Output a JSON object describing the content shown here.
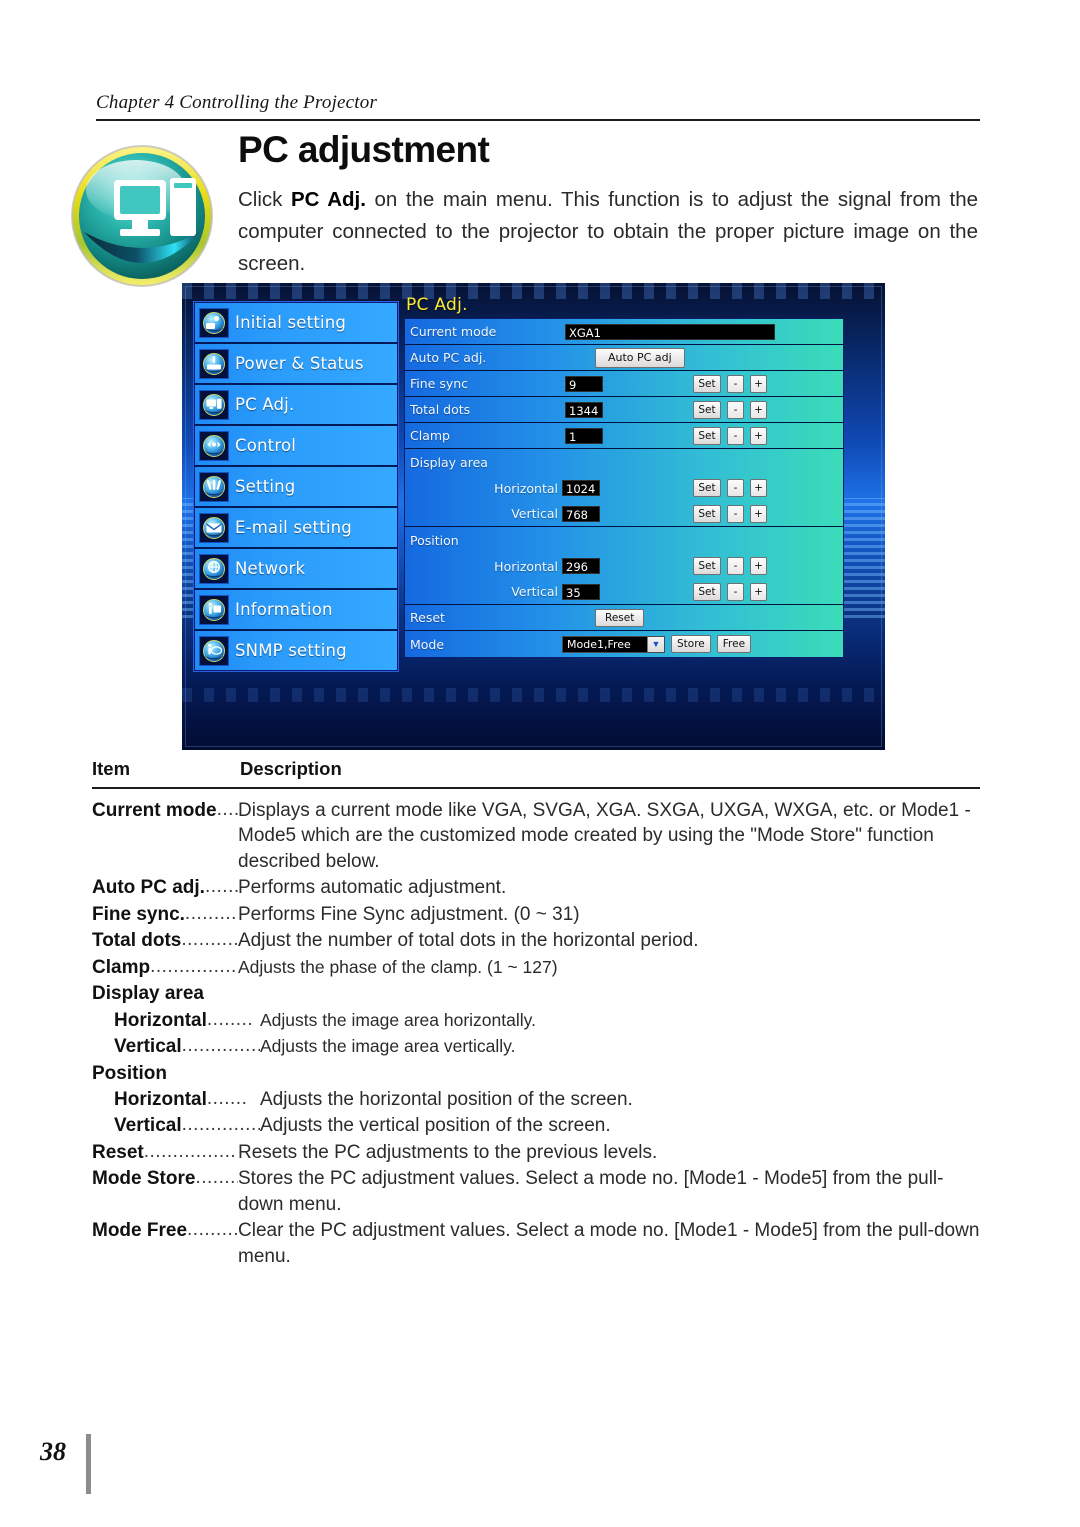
{
  "header": {
    "chapter": "Chapter 4 Controlling the Projector"
  },
  "title": "PC adjustment",
  "intro": {
    "pre": "Click ",
    "bold": "PC Adj.",
    "post": " on the main menu. This function is to adjust the signal from the computer connected to the projector to obtain the proper picture image on the screen."
  },
  "badge": {
    "icon": "computer-monitor-tower-icon",
    "ring_color": "#f2e430",
    "body_color": "#17a69e"
  },
  "screenshot": {
    "nav": {
      "items": [
        {
          "label": "Initial setting",
          "icon": "initial-setting-icon"
        },
        {
          "label": "Power & Status",
          "icon": "power-status-icon"
        },
        {
          "label": "PC Adj.",
          "icon": "pc-adj-icon"
        },
        {
          "label": "Control",
          "icon": "control-icon"
        },
        {
          "label": "Setting",
          "icon": "setting-icon"
        },
        {
          "label": "E-mail setting",
          "icon": "email-icon"
        },
        {
          "label": "Network",
          "icon": "network-icon"
        },
        {
          "label": "Information",
          "icon": "information-icon"
        },
        {
          "label": "SNMP setting",
          "icon": "snmp-setting-icon"
        }
      ]
    },
    "panel": {
      "title": "PC Adj.",
      "title_color": "#ffe92e",
      "row_gradient_start": "#1569e0",
      "row_gradient_end": "#3bdcb8",
      "rows": {
        "current_mode": {
          "label": "Current mode",
          "value": "XGA1"
        },
        "auto_pc_adj": {
          "label": "Auto PC adj.",
          "button": "Auto PC adj"
        },
        "fine_sync": {
          "label": "Fine sync",
          "value": "9"
        },
        "total_dots": {
          "label": "Total dots",
          "value": "1344"
        },
        "clamp": {
          "label": "Clamp",
          "value": "1"
        },
        "display_area": {
          "label": "Display area",
          "horizontal": {
            "label": "Horizontal",
            "value": "1024"
          },
          "vertical": {
            "label": "Vertical",
            "value": "768"
          }
        },
        "position": {
          "label": "Position",
          "horizontal": {
            "label": "Horizontal",
            "value": "296"
          },
          "vertical": {
            "label": "Vertical",
            "value": "35"
          }
        },
        "reset": {
          "label": "Reset",
          "button": "Reset"
        },
        "mode": {
          "label": "Mode",
          "value": "Mode1,Free",
          "store_button": "Store",
          "free_button": "Free"
        }
      },
      "buttons": {
        "set": "Set",
        "minus": "-",
        "plus": "+",
        "dropdown_arrow": "▼"
      }
    }
  },
  "table": {
    "head": {
      "item": "Item",
      "description": "Description"
    },
    "rows": [
      {
        "term": "Current mode",
        "leader": "......",
        "body": "Displays a current mode like VGA, SVGA, XGA. SXGA, UXGA, WXGA, etc. or Mode1 - Mode5 which are the customized mode created by using the \"Mode Store\" function described below."
      },
      {
        "term": "Auto PC adj.",
        "leader": "..........",
        "body": "Performs automatic adjustment."
      },
      {
        "term": "Fine sync.",
        "leader": "..............",
        "body": "Performs Fine Sync adjustment. (0 ~ 31)"
      },
      {
        "term": "Total dots",
        "leader": "..............",
        "body": "Adjust the number of total dots in the horizontal period."
      },
      {
        "term": "Clamp",
        "leader": ".......................",
        "body": "Adjusts the phase of the clamp. (1 ~ 127)",
        "small": true
      },
      {
        "group": "Display area"
      },
      {
        "term": "Horizontal",
        "leader": "........",
        "indent": true,
        "body": "Adjusts the image area horizontally.",
        "small": true
      },
      {
        "term": "Vertical",
        "leader": "..............",
        "indent": true,
        "body": "Adjusts the image area vertically.",
        "small": true
      },
      {
        "group": "Position"
      },
      {
        "term": "Horizontal",
        "leader": ".......",
        "indent": true,
        "body": "Adjusts the horizontal position of the screen."
      },
      {
        "term": "Vertical",
        "leader": "..............",
        "indent": true,
        "body": "Adjusts the vertical position of the screen."
      },
      {
        "term": "Reset",
        "leader": ".......................",
        "body": "Resets the PC adjustments to the previous levels."
      },
      {
        "term": "Mode Store",
        "leader": "..........",
        "body": "Stores the PC adjustment values. Select a mode no. [Mode1 - Mode5] from the pull-down menu."
      },
      {
        "term": "Mode Free",
        "leader": "...........",
        "body": "Clear the PC adjustment values. Select a mode no.  [Mode1 - Mode5] from the pull-down menu."
      }
    ]
  },
  "footer": {
    "page_number": "38"
  }
}
